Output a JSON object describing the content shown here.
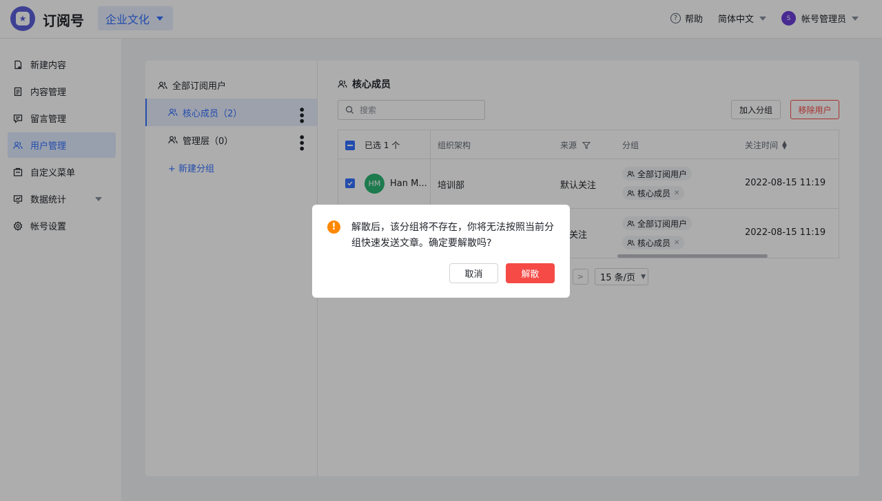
{
  "header": {
    "app_title": "订阅号",
    "account_switch": "企业文化",
    "help": "帮助",
    "language": "简体中文",
    "user_avatar": "S",
    "user_name": "帐号管理员"
  },
  "sidebar": {
    "items": [
      {
        "label": "新建内容",
        "icon": "new-content-icon"
      },
      {
        "label": "内容管理",
        "icon": "document-icon"
      },
      {
        "label": "留言管理",
        "icon": "comment-icon"
      },
      {
        "label": "用户管理",
        "icon": "users-icon",
        "active": true
      },
      {
        "label": "自定义菜单",
        "icon": "menu-icon"
      },
      {
        "label": "数据统计",
        "icon": "stats-icon",
        "expandable": true
      },
      {
        "label": "帐号设置",
        "icon": "gear-icon"
      }
    ]
  },
  "groups": {
    "all_label": "全部订阅用户",
    "items": [
      {
        "label": "核心成员（2）",
        "active": true
      },
      {
        "label": "管理层（0）"
      }
    ],
    "new_group": "+ 新建分组"
  },
  "main": {
    "title": "核心成员",
    "search_placeholder": "搜索",
    "join_group": "加入分组",
    "remove_user": "移除用户",
    "table": {
      "selected": "已选 1 个",
      "headers": [
        "组织架构",
        "来源",
        "分组",
        "关注时间"
      ],
      "rows": [
        {
          "avatar": "HM",
          "name": "Han M...",
          "org": "培训部",
          "source": "默认关注",
          "tags": [
            "全部订阅用户",
            "核心成员"
          ],
          "time": "2022-08-15 11:19"
        },
        {
          "org": "",
          "source": "认关注",
          "tags": [
            "全部订阅用户",
            "核心成员"
          ],
          "time": "2022-08-15 11:19"
        }
      ]
    },
    "pagination": {
      "next": ">",
      "page_size": "15 条/页"
    }
  },
  "dialog": {
    "message": "解散后，该分组将不存在，你将无法按照当前分组快速发送文章。确定要解散吗?",
    "cancel": "取消",
    "confirm": "解散"
  },
  "colors": {
    "accent": "#3370ff",
    "danger": "#f54a45",
    "warning": "#ff8800"
  }
}
